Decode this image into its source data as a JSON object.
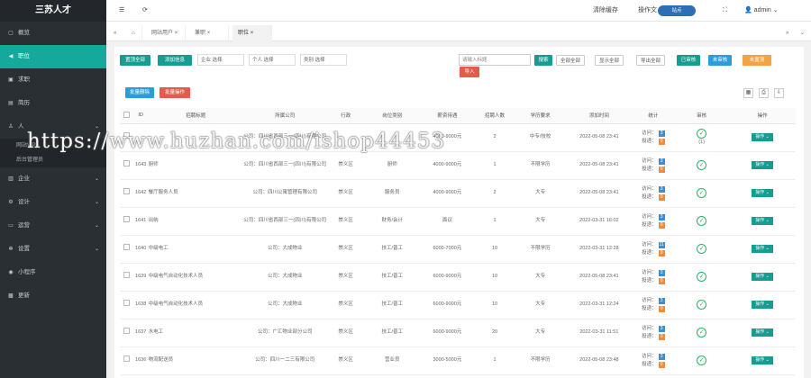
{
  "app": {
    "title": "三苏人才"
  },
  "sidebar": {
    "items": [
      {
        "icon": "home-icon",
        "label": "概览",
        "chev": ""
      },
      {
        "icon": "megaphone-icon",
        "label": "职位",
        "chev": ""
      },
      {
        "icon": "apps-icon",
        "label": "求职",
        "chev": ""
      },
      {
        "icon": "document-icon",
        "label": "简历",
        "chev": ""
      },
      {
        "icon": "user-icon",
        "label": "人",
        "chev": "⌄"
      },
      {
        "icon": "building-icon",
        "label": "企业",
        "chev": "⌄"
      },
      {
        "icon": "gear-icon",
        "label": "设计",
        "chev": "⌄"
      },
      {
        "icon": "monitor-icon",
        "label": "运营",
        "chev": "⌄"
      },
      {
        "icon": "settings-icon",
        "label": "设置",
        "chev": "⌄"
      },
      {
        "icon": "miniapp-icon",
        "label": "小程序",
        "chev": ""
      },
      {
        "icon": "shop-icon",
        "label": "更新",
        "chev": ""
      }
    ],
    "subitems": [
      "网站VIP",
      "后台管理员"
    ]
  },
  "topbar": {
    "menu_icon": "☰",
    "refresh_icon": "⟳",
    "clear_cache": "清除缓存",
    "ops": "操作文",
    "search_placeholder": "站点",
    "fullscreen_icon": "⛶",
    "user": "admin"
  },
  "tabs": [
    {
      "label": "⌂",
      "close": ""
    },
    {
      "label": "网站用户",
      "close": "×"
    },
    {
      "label": "兼职",
      "close": "×"
    },
    {
      "label": "职位",
      "close": "×"
    }
  ],
  "toolbar": {
    "btn_manage": "置顶全部",
    "btn_add": "添加信息",
    "sel_company": "企业 选择",
    "sel_person": "个人 选择",
    "sel_type": "类别 选择",
    "search_placeholder": "请输入标题",
    "btn_search": "搜索",
    "btn_all": "全部全部",
    "btn_show": "显示全部",
    "btn_export": "导出全部",
    "btn_audited": "已审核",
    "btn_unaudited": "未审核",
    "btn_top": "未置顶",
    "btn_import": "导入",
    "btn_batch_del": "批量删除",
    "btn_batch_op": "批量操作"
  },
  "table": {
    "headers": [
      "",
      "ID",
      "招聘标题",
      "所属公司",
      "行政",
      "岗位类别",
      "薪资待遇",
      "招聘人数",
      "学历要求",
      "添加时间",
      "统计",
      "审核",
      "操作"
    ],
    "rows": [
      {
        "id": "",
        "title": "",
        "company": "公司：四川省西部三一(四川)有限公司",
        "area": "",
        "category": "",
        "salary": "4000-9000元",
        "count": "2",
        "edu": "中专/技校",
        "time": "2022-05-08 23:41",
        "visits": "3",
        "apps": "0"
      },
      {
        "id": "1643",
        "title": "厨师",
        "company": "公司：四川省西部三一(四川)有限公司",
        "area": "崇义区",
        "category": "厨师",
        "salary": "4000-9000元",
        "count": "1",
        "edu": "不限学历",
        "time": "2022-05-08 23:41",
        "visits": "3",
        "apps": "0"
      },
      {
        "id": "1642",
        "title": "餐厅服务人员",
        "company": "公司：四川公寓管理有限公司",
        "area": "崇义区",
        "category": "服务员",
        "salary": "4000-9000元",
        "count": "2",
        "edu": "大专",
        "time": "2022-05-08 23:41",
        "visits": "3",
        "apps": "0"
      },
      {
        "id": "1641",
        "title": "出纳",
        "company": "公司：四川省西部三一(四川)有限公司",
        "area": "崇义区",
        "category": "财务/会计",
        "salary": "面议",
        "count": "1",
        "edu": "大专",
        "time": "2022-03-31 16:02",
        "visits": "3",
        "apps": "0"
      },
      {
        "id": "1640",
        "title": "中级电工",
        "company": "公司：大成物业",
        "area": "崇义区",
        "category": "技工/普工",
        "salary": "6000-7000元",
        "count": "10",
        "edu": "不限学历",
        "time": "2022-03-31 12:28",
        "visits": "11",
        "apps": "0"
      },
      {
        "id": "1639",
        "title": "中级电气自动化技术人员",
        "company": "公司：大成物业",
        "area": "崇义区",
        "category": "技工/普工",
        "salary": "6000-9000元",
        "count": "10",
        "edu": "大专",
        "time": "2022-05-08 23:41",
        "visits": "3",
        "apps": "0"
      },
      {
        "id": "1638",
        "title": "中级电气自动化技术人员",
        "company": "公司：大成物业",
        "area": "崇义区",
        "category": "技工/普工",
        "salary": "6000-9000元",
        "count": "10",
        "edu": "大专",
        "time": "2022-03-31 12:24",
        "visits": "3",
        "apps": "0"
      },
      {
        "id": "1637",
        "title": "水电工",
        "company": "公司：广汇物业部分公司",
        "area": "崇义区",
        "category": "技工/普工",
        "salary": "6000-9000元",
        "count": "20",
        "edu": "大专",
        "time": "2022-03-31 11:51",
        "visits": "3",
        "apps": "0"
      },
      {
        "id": "1636",
        "title": "物流配送员",
        "company": "公司：四川一二三有限公司",
        "area": "崇义区",
        "category": "营业员",
        "salary": "3000-5000元",
        "count": "1",
        "edu": "不限学历",
        "time": "2022-05-08 23:48",
        "visits": "3",
        "apps": "0"
      }
    ],
    "visit_label": "访问：",
    "apply_label": "投递：",
    "op_label": "操作 ⌄",
    "first_row_status": "(1)"
  },
  "watermark": "https://www.huzhan.com/ishop44453"
}
